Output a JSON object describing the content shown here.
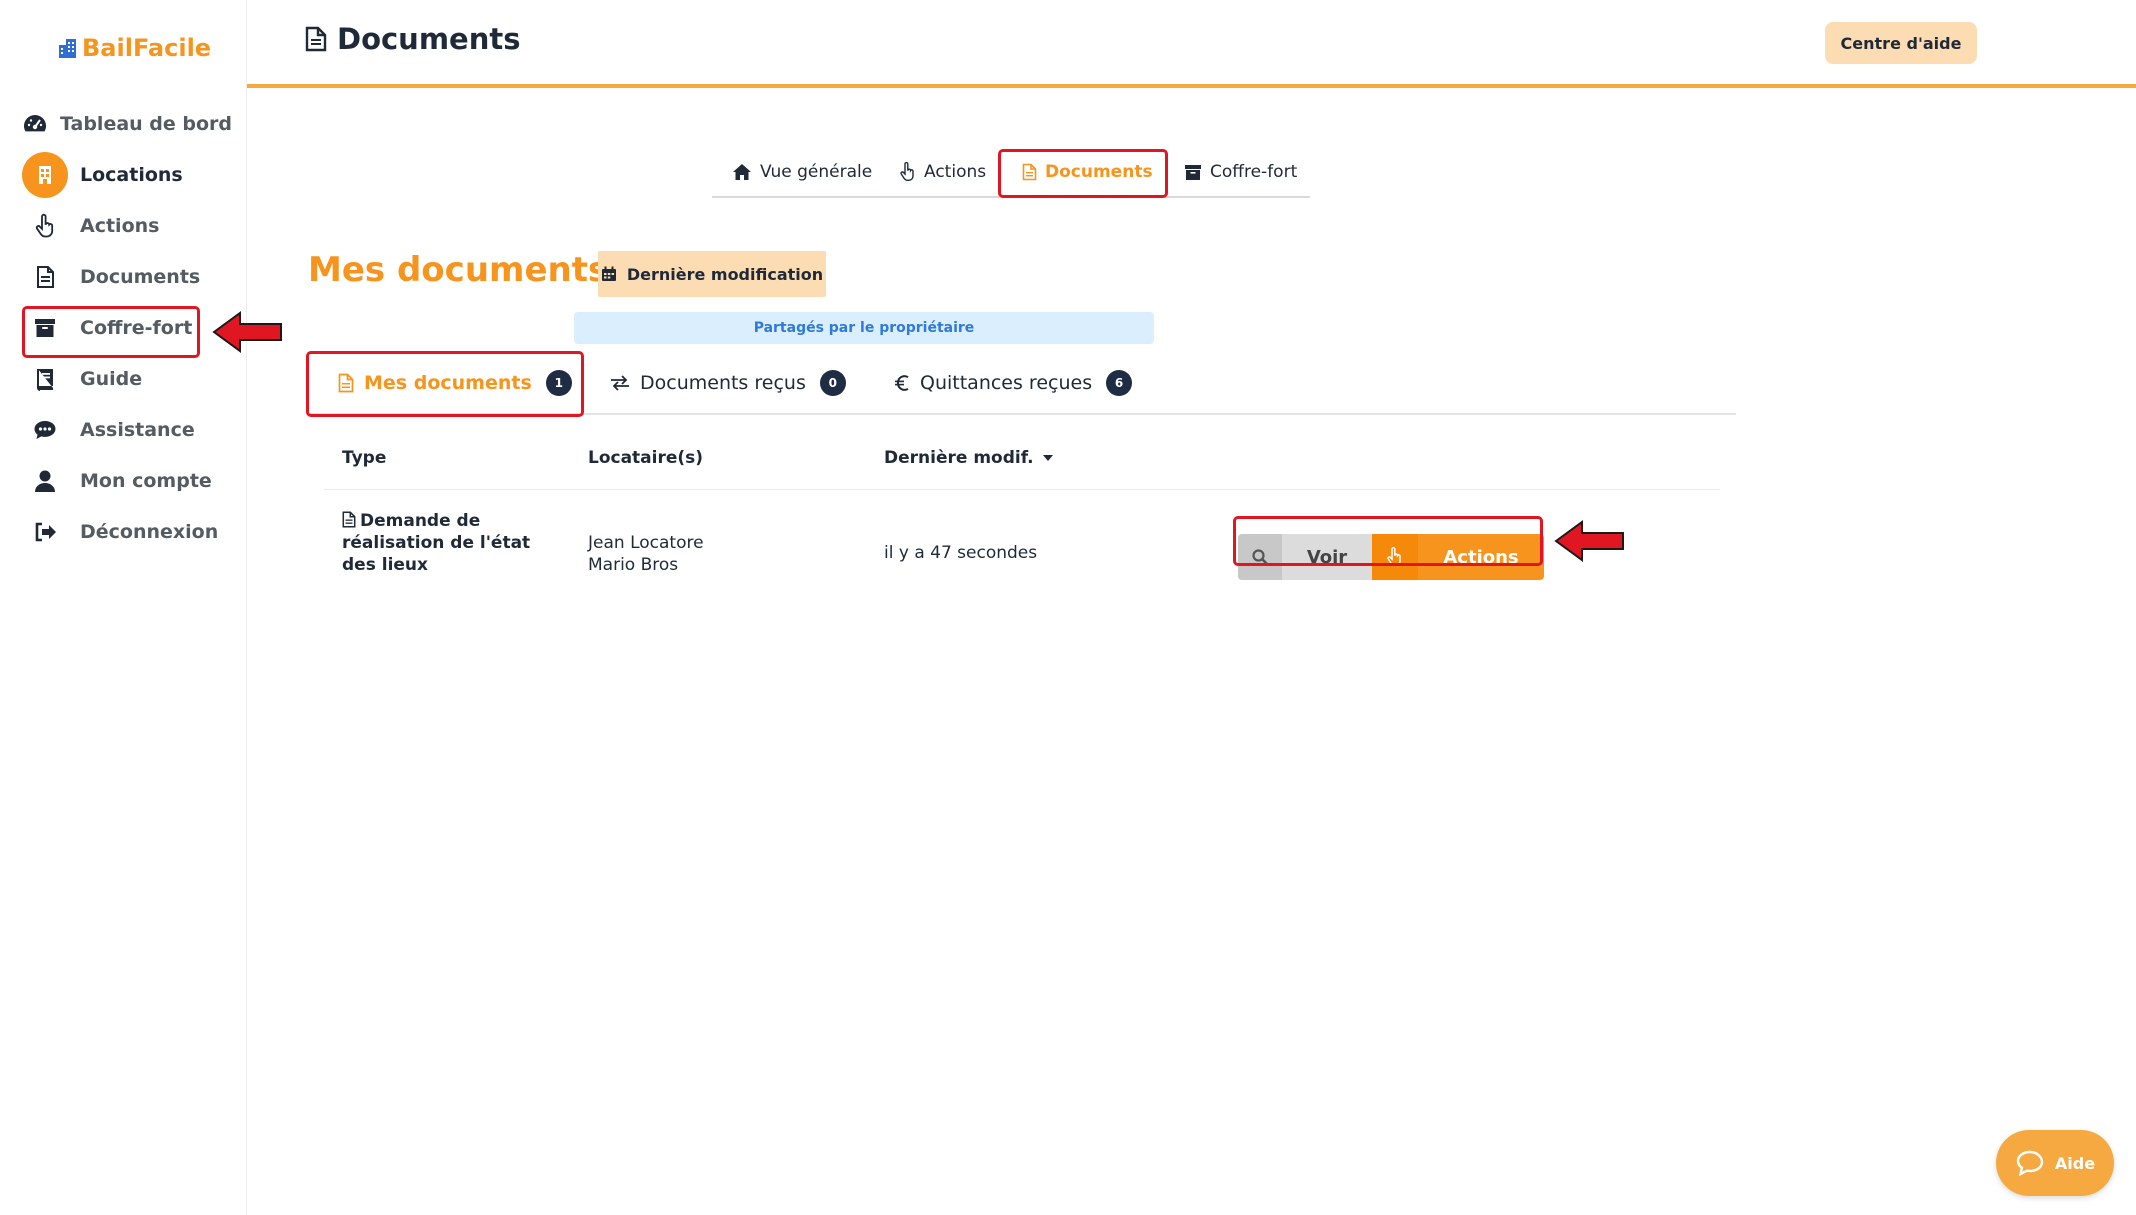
{
  "brand": {
    "name": "BailFacile"
  },
  "sidebar": {
    "items": [
      {
        "label": "Tableau de bord",
        "icon": "dashboard-gauge-icon"
      },
      {
        "label": "Locations",
        "icon": "building-icon"
      },
      {
        "label": "Actions",
        "icon": "pointer-hand-icon"
      },
      {
        "label": "Documents",
        "icon": "document-icon"
      },
      {
        "label": "Coffre-fort",
        "icon": "archive-box-icon"
      },
      {
        "label": "Guide",
        "icon": "book-icon"
      },
      {
        "label": "Assistance",
        "icon": "chat-bubble-icon"
      },
      {
        "label": "Mon compte",
        "icon": "user-icon"
      },
      {
        "label": "Déconnexion",
        "icon": "logout-icon"
      }
    ],
    "active": "Locations"
  },
  "header": {
    "title": "Documents",
    "help_center_label": "Centre d'aide"
  },
  "top_tabs": [
    {
      "label": "Vue générale",
      "icon": "home-icon"
    },
    {
      "label": "Actions",
      "icon": "pointer-hand-icon"
    },
    {
      "label": "Documents",
      "icon": "document-icon",
      "active": true
    },
    {
      "label": "Coffre-fort",
      "icon": "archive-box-icon"
    }
  ],
  "section": {
    "title": "Mes documents",
    "sort_label": "Dernière modification",
    "shared_banner": "Partagés par le propriétaire"
  },
  "doc_tabs": [
    {
      "label": "Mes documents",
      "count": "1",
      "icon": "document-icon",
      "active": true
    },
    {
      "label": "Documents reçus",
      "count": "0",
      "icon": "exchange-arrows-icon"
    },
    {
      "label": "Quittances reçues",
      "count": "6",
      "icon": "euro-icon"
    }
  ],
  "table": {
    "columns": [
      "Type",
      "Locataire(s)",
      "Dernière modif."
    ],
    "rows": [
      {
        "type": "Demande de réalisation de l'état des lieux",
        "tenants": [
          "Jean Locatore",
          "Mario Bros"
        ],
        "modified": "il y a 47 secondes",
        "view_label": "Voir",
        "actions_label": "Actions"
      }
    ]
  },
  "floating_help": {
    "label": "Aide"
  },
  "colors": {
    "accent": "#f7941d",
    "accent_light": "#fcdcb3",
    "annotation_red": "#e01622",
    "badge_dark": "#1e2d44",
    "banner_blue": "#dbeefe"
  }
}
